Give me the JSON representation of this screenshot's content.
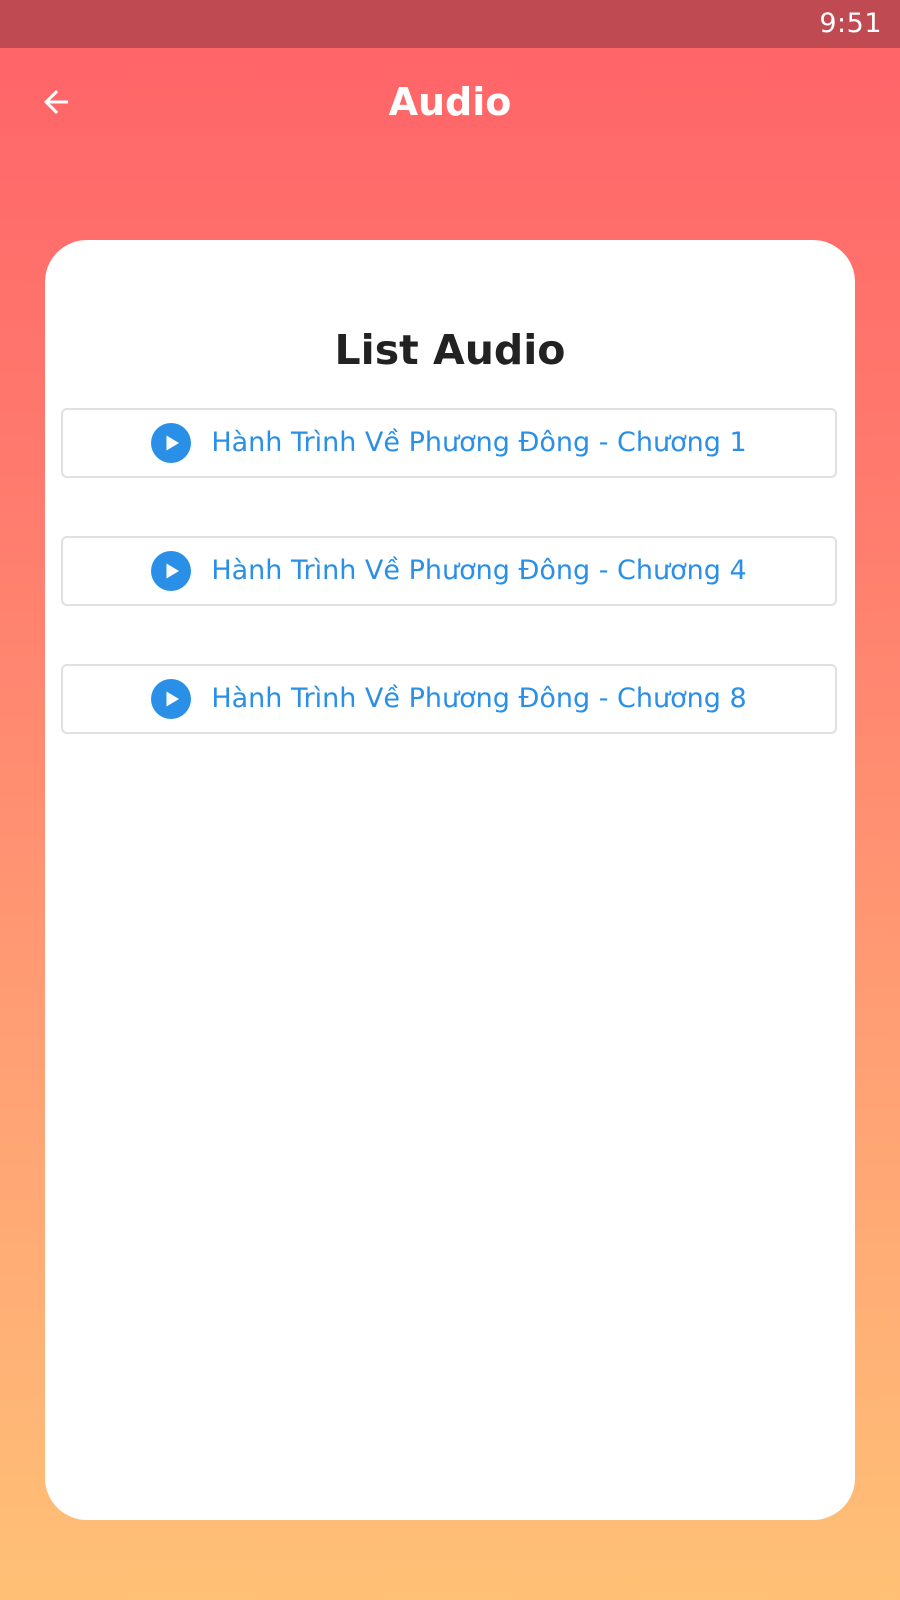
{
  "status_bar": {
    "time": "9:51"
  },
  "app_bar": {
    "title": "Audio",
    "back_icon": "arrow-left-icon"
  },
  "colors": {
    "status_bar_bg": "#c04a52",
    "gradient_top": "#ff6268",
    "gradient_bottom": "#ffc176",
    "accent_blue": "#2a8fe6",
    "card_bg": "#ffffff",
    "title_text": "#222222"
  },
  "card": {
    "title": "List Audio",
    "items": [
      {
        "label": "Hành Trình Về Phương Đông - Chương 1",
        "icon": "play-circle-icon"
      },
      {
        "label": "Hành Trình Về Phương Đông - Chương 4",
        "icon": "play-circle-icon"
      },
      {
        "label": "Hành Trình Về Phương Đông - Chương 8",
        "icon": "play-circle-icon"
      }
    ]
  }
}
